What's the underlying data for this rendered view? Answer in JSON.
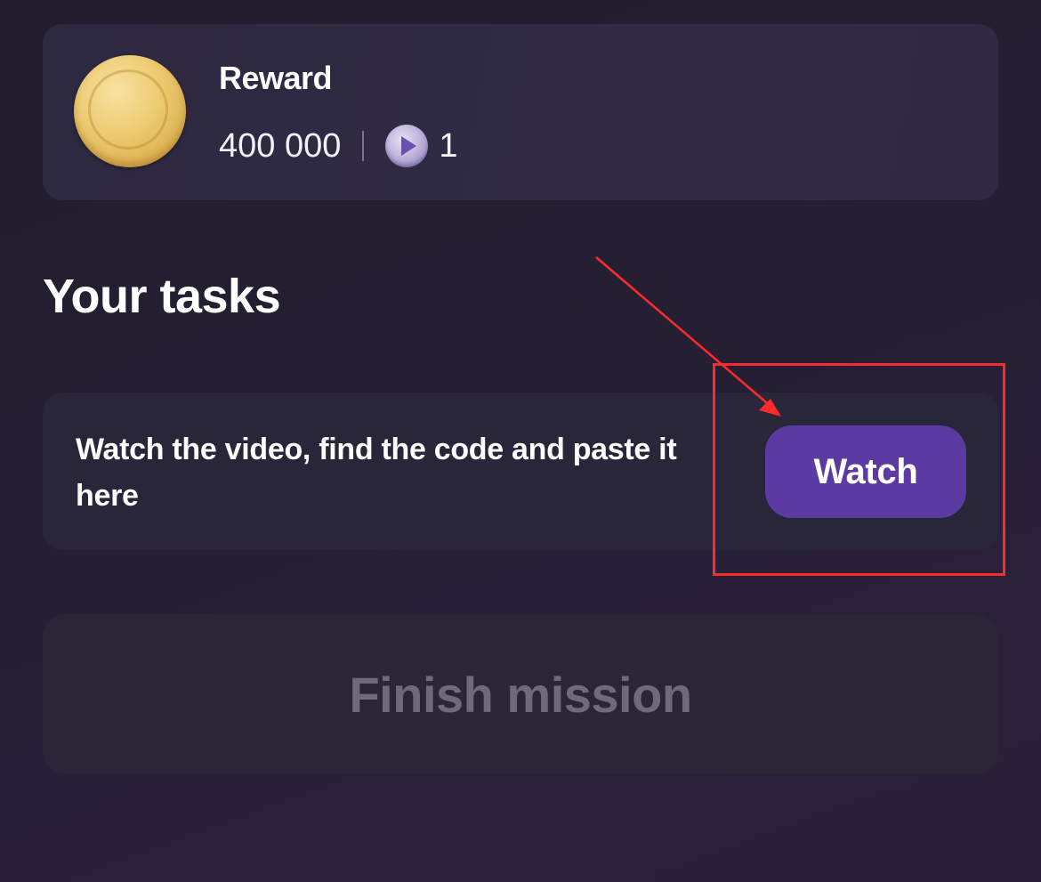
{
  "reward": {
    "title": "Reward",
    "amount": "400 000",
    "token_count": "1",
    "coin_icon": "gold-coin-icon",
    "token_icon": "play-token-icon"
  },
  "tasks": {
    "heading": "Your tasks",
    "items": [
      {
        "text": "Watch the video, find the code and paste it here",
        "button_label": "Watch"
      }
    ]
  },
  "finish": {
    "label": "Finish mission",
    "enabled": false
  },
  "colors": {
    "accent": "#5b3ba1",
    "annotation": "#ff2b2b",
    "disabled_text": "#6e6a7c"
  }
}
